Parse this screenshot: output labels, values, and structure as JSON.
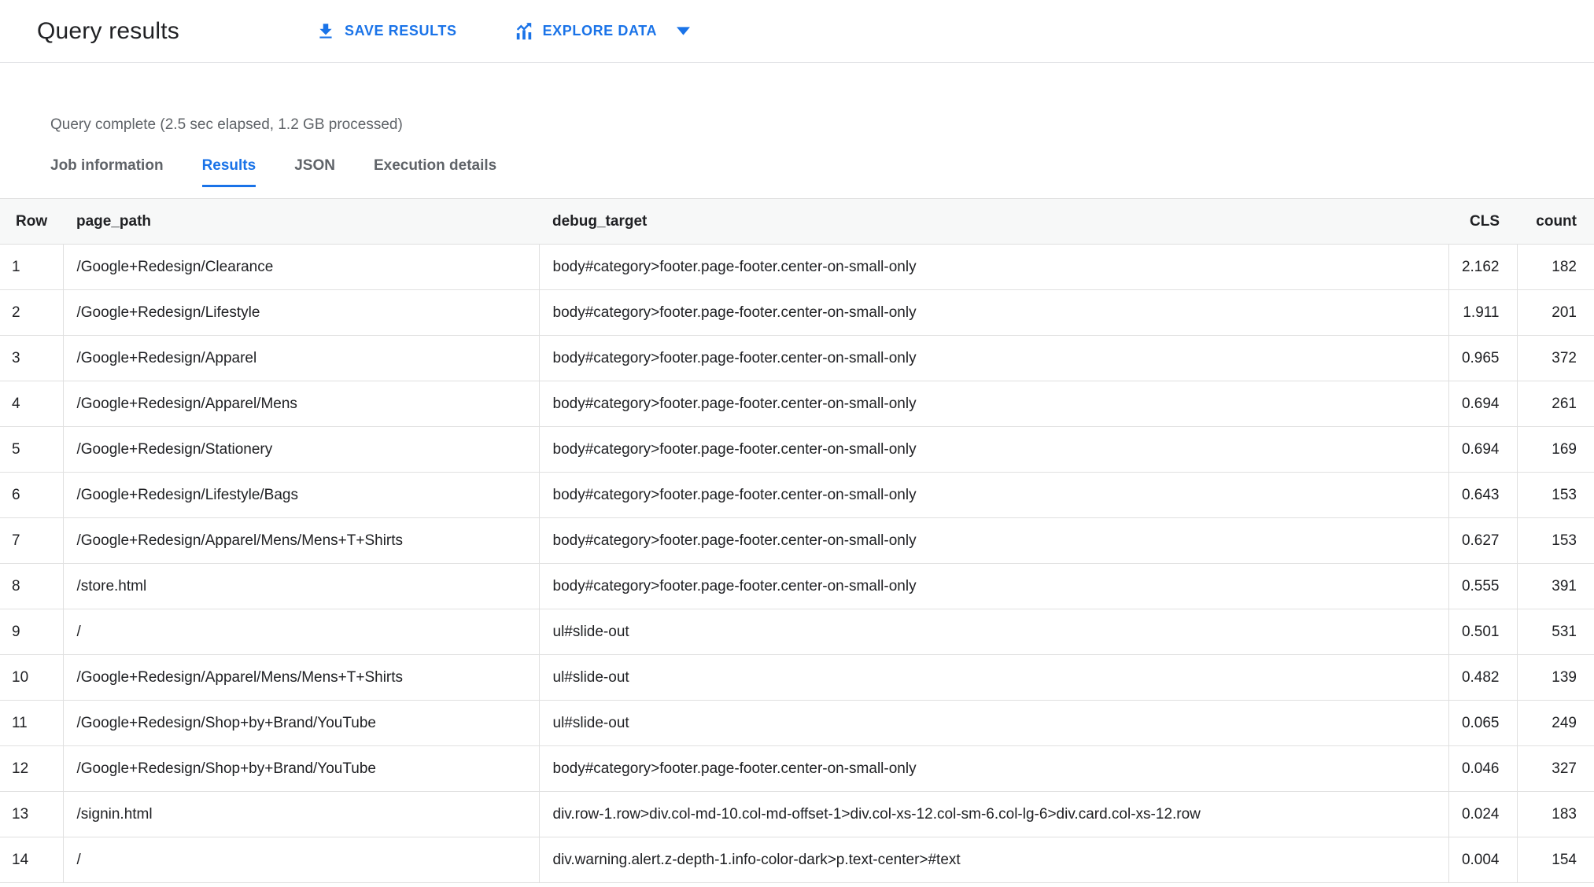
{
  "header": {
    "title": "Query results",
    "buttons": {
      "save_results": "SAVE RESULTS",
      "explore_data": "EXPLORE DATA"
    }
  },
  "status_text": "Query complete (2.5 sec elapsed, 1.2 GB processed)",
  "tabs": [
    {
      "label": "Job information",
      "active": false
    },
    {
      "label": "Results",
      "active": true
    },
    {
      "label": "JSON",
      "active": false
    },
    {
      "label": "Execution details",
      "active": false
    }
  ],
  "table": {
    "columns": [
      "Row",
      "page_path",
      "debug_target",
      "CLS",
      "count"
    ],
    "rows": [
      {
        "row": "1",
        "page_path": "/Google+Redesign/Clearance",
        "debug_target": "body#category>footer.page-footer.center-on-small-only",
        "cls": "2.162",
        "count": "182"
      },
      {
        "row": "2",
        "page_path": "/Google+Redesign/Lifestyle",
        "debug_target": "body#category>footer.page-footer.center-on-small-only",
        "cls": "1.911",
        "count": "201"
      },
      {
        "row": "3",
        "page_path": "/Google+Redesign/Apparel",
        "debug_target": "body#category>footer.page-footer.center-on-small-only",
        "cls": "0.965",
        "count": "372"
      },
      {
        "row": "4",
        "page_path": "/Google+Redesign/Apparel/Mens",
        "debug_target": "body#category>footer.page-footer.center-on-small-only",
        "cls": "0.694",
        "count": "261"
      },
      {
        "row": "5",
        "page_path": "/Google+Redesign/Stationery",
        "debug_target": "body#category>footer.page-footer.center-on-small-only",
        "cls": "0.694",
        "count": "169"
      },
      {
        "row": "6",
        "page_path": "/Google+Redesign/Lifestyle/Bags",
        "debug_target": "body#category>footer.page-footer.center-on-small-only",
        "cls": "0.643",
        "count": "153"
      },
      {
        "row": "7",
        "page_path": "/Google+Redesign/Apparel/Mens/Mens+T+Shirts",
        "debug_target": "body#category>footer.page-footer.center-on-small-only",
        "cls": "0.627",
        "count": "153"
      },
      {
        "row": "8",
        "page_path": "/store.html",
        "debug_target": "body#category>footer.page-footer.center-on-small-only",
        "cls": "0.555",
        "count": "391"
      },
      {
        "row": "9",
        "page_path": "/",
        "debug_target": "ul#slide-out",
        "cls": "0.501",
        "count": "531"
      },
      {
        "row": "10",
        "page_path": "/Google+Redesign/Apparel/Mens/Mens+T+Shirts",
        "debug_target": "ul#slide-out",
        "cls": "0.482",
        "count": "139"
      },
      {
        "row": "11",
        "page_path": "/Google+Redesign/Shop+by+Brand/YouTube",
        "debug_target": "ul#slide-out",
        "cls": "0.065",
        "count": "249"
      },
      {
        "row": "12",
        "page_path": "/Google+Redesign/Shop+by+Brand/YouTube",
        "debug_target": "body#category>footer.page-footer.center-on-small-only",
        "cls": "0.046",
        "count": "327"
      },
      {
        "row": "13",
        "page_path": "/signin.html",
        "debug_target": "div.row-1.row>div.col-md-10.col-md-offset-1>div.col-xs-12.col-sm-6.col-lg-6>div.card.col-xs-12.row",
        "cls": "0.024",
        "count": "183"
      },
      {
        "row": "14",
        "page_path": "/",
        "debug_target": "div.warning.alert.z-depth-1.info-color-dark>p.text-center>#text",
        "cls": "0.004",
        "count": "154"
      }
    ]
  },
  "colors": {
    "accent_blue": "#1a73e8",
    "text_primary": "#202124",
    "text_secondary": "#5f6368",
    "border": "#e0e0e0",
    "table_header_bg": "#f7f8f8"
  }
}
